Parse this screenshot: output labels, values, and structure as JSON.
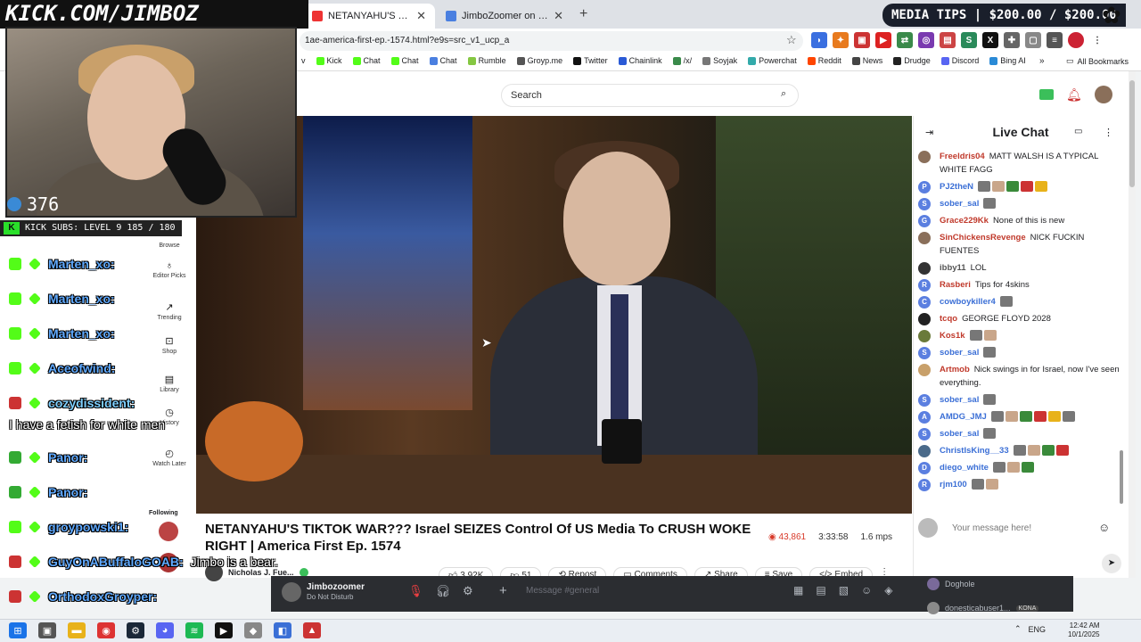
{
  "browser": {
    "tabs": [
      {
        "title": "NETANYAHU'S TIKTOK WAR",
        "active": true
      },
      {
        "title": "JimboZoomer on Cozy.tv",
        "active": false
      }
    ],
    "url": "1ae-america-first-ep.-1574.html?e9s=src_v1_ucp_a",
    "bookmarks": [
      "v",
      "Kick",
      "Chat",
      "Chat",
      "Chat",
      "Rumble",
      "Groyp.me",
      "Twitter",
      "Chainlink",
      "/x/",
      "Soyjak",
      "Powerchat",
      "Reddit",
      "News",
      "Drudge",
      "Discord",
      "Bing AI"
    ],
    "bookmarks_more": "»",
    "all_bookmarks": "All Bookmarks"
  },
  "site": {
    "search_placeholder": "Search",
    "left_nav": [
      {
        "label": "Browse",
        "icon": "browse-icon"
      },
      {
        "label": "Editor Picks",
        "icon": "award-icon"
      },
      {
        "label": "Trending",
        "icon": "trending-icon"
      },
      {
        "label": "Shop",
        "icon": "shop-icon"
      },
      {
        "label": "Library",
        "icon": "library-icon"
      },
      {
        "label": "History",
        "icon": "history-icon"
      },
      {
        "label": "Watch Later",
        "icon": "clock-icon"
      }
    ],
    "following_label": "Following"
  },
  "video": {
    "title": "NETANYAHU'S TIKTOK WAR??? Israel SEIZES Control Of US Media To CRUSH WOKE RIGHT | America First Ep. 1574",
    "views": "43,861",
    "duration": "3:33:58",
    "mps": "1.6 mps",
    "channel": "Nicholas J. Fue...",
    "likes": "3.92K",
    "dislikes": "51",
    "actions": [
      "Repost",
      "Comments",
      "Share",
      "Save",
      "Embed"
    ]
  },
  "live_chat": {
    "title": "Live Chat",
    "input_placeholder": "Your message here!",
    "messages": [
      {
        "user": "Freeldris04",
        "color": "#c0392b",
        "text": "MATT WALSH IS A TYPICAL WHITE FAGG",
        "avatar_color": "#8a6f5a",
        "avatar_letter": ""
      },
      {
        "user": "PJ2theN",
        "color": "#3b6fd6",
        "text": "",
        "avatar_color": "#5b7fe0",
        "avatar_letter": "P",
        "emotes": 5
      },
      {
        "user": "sober_sal",
        "color": "#3b6fd6",
        "text": "",
        "avatar_color": "#5b7fe0",
        "avatar_letter": "S",
        "emotes": 1
      },
      {
        "user": "Grace229Kk",
        "color": "#c0392b",
        "text": "None of this is new",
        "avatar_color": "#5b7fe0",
        "avatar_letter": "G"
      },
      {
        "user": "SinChickensRevenge",
        "color": "#c0392b",
        "text": "NICK FUCKIN FUENTES",
        "avatar_color": "#8a6f5a",
        "avatar_letter": ""
      },
      {
        "user": "ibby11",
        "color": "#555",
        "text": "LOL",
        "avatar_color": "#333",
        "avatar_letter": ""
      },
      {
        "user": "Rasberi",
        "color": "#c0392b",
        "text": "Tips for 4skins",
        "avatar_color": "#5b7fe0",
        "avatar_letter": "R"
      },
      {
        "user": "cowboykiller4",
        "color": "#3b6fd6",
        "text": "",
        "avatar_color": "#5b7fe0",
        "avatar_letter": "C",
        "emotes": 1
      },
      {
        "user": "tcqo",
        "color": "#c0392b",
        "text": "GEORGE FLOYD 2028",
        "avatar_color": "#222",
        "avatar_letter": ""
      },
      {
        "user": "Kos1k",
        "color": "#c0392b",
        "text": "",
        "avatar_color": "#6a7a3a",
        "avatar_letter": "",
        "emotes": 2
      },
      {
        "user": "sober_sal",
        "color": "#3b6fd6",
        "text": "",
        "avatar_color": "#5b7fe0",
        "avatar_letter": "S",
        "emotes": 1
      },
      {
        "user": "Artmob",
        "color": "#c0392b",
        "text": "Nick swings in for Israel, now I've seen everything.",
        "avatar_color": "#c8a06a",
        "avatar_letter": ""
      },
      {
        "user": "sober_sal",
        "color": "#3b6fd6",
        "text": "",
        "avatar_color": "#5b7fe0",
        "avatar_letter": "S",
        "emotes": 1
      },
      {
        "user": "AMDG_JMJ",
        "color": "#3b6fd6",
        "text": "",
        "avatar_color": "#5b7fe0",
        "avatar_letter": "A",
        "emotes": 6
      },
      {
        "user": "sober_sal",
        "color": "#3b6fd6",
        "text": "",
        "avatar_color": "#5b7fe0",
        "avatar_letter": "S",
        "emotes": 1
      },
      {
        "user": "ChristIsKing__33",
        "color": "#3b6fd6",
        "text": "",
        "avatar_color": "#4a6a8a",
        "avatar_letter": "",
        "emotes": 4
      },
      {
        "user": "diego_white",
        "color": "#3b6fd6",
        "text": "",
        "avatar_color": "#5b7fe0",
        "avatar_letter": "D",
        "emotes": 3
      },
      {
        "user": "rjm100",
        "color": "#3b6fd6",
        "text": "",
        "avatar_color": "#5b7fe0",
        "avatar_letter": "R",
        "emotes": 2
      }
    ]
  },
  "overlay": {
    "banner": "KICK.COM/JIMBOZ",
    "viewer_count": "376",
    "kick_subs": "KICK SUBS: LEVEL 9 185 / 180",
    "media_tips": "MEDIA TIPS | $200.00 / $200.00",
    "chat": [
      {
        "user": "Marten_xo:",
        "text": ""
      },
      {
        "user": "Marten_xo:",
        "text": ""
      },
      {
        "user": "Marten_xo:",
        "text": ""
      },
      {
        "user": "Aceofwind:",
        "text": ""
      },
      {
        "user": "cozydissident:",
        "text": "I have a fetish for white men"
      },
      {
        "user": "Panor:",
        "text": ""
      },
      {
        "user": "Panor:",
        "text": ""
      },
      {
        "user": "groypowski1:",
        "text": ""
      },
      {
        "user": "GuyOnABuffaloGOAB:",
        "text": "Jimbo is a bear."
      },
      {
        "user": "OrthodoxGroyper:",
        "text": ""
      }
    ]
  },
  "discord": {
    "username": "Jimbozoomer",
    "status": "Do Not Disturb",
    "message_placeholder": "Message #general",
    "members": [
      {
        "name": "Doghole",
        "tag": ""
      },
      {
        "name": "donesticabuser1...",
        "tag": "KONA"
      }
    ]
  },
  "taskbar": {
    "language": "ENG",
    "time": "12:42 AM",
    "date": "10/1/2025"
  },
  "colors": {
    "kick_green": "#53fc18",
    "views_red": "#d83a2a",
    "discord_bg": "#2b2d31"
  }
}
